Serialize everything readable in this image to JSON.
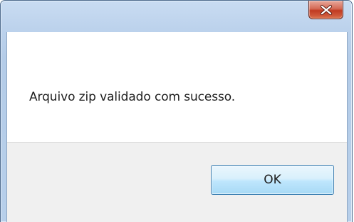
{
  "window": {
    "close_icon": "close-x-icon"
  },
  "dialog": {
    "message": "Arquivo zip validado com sucesso.",
    "ok_label": "OK"
  },
  "colors": {
    "close_button_red": "#c13a22",
    "ok_button_border": "#3c7fb1",
    "title_bar": "#bcd2ec",
    "button_area": "#f0f0f0"
  }
}
